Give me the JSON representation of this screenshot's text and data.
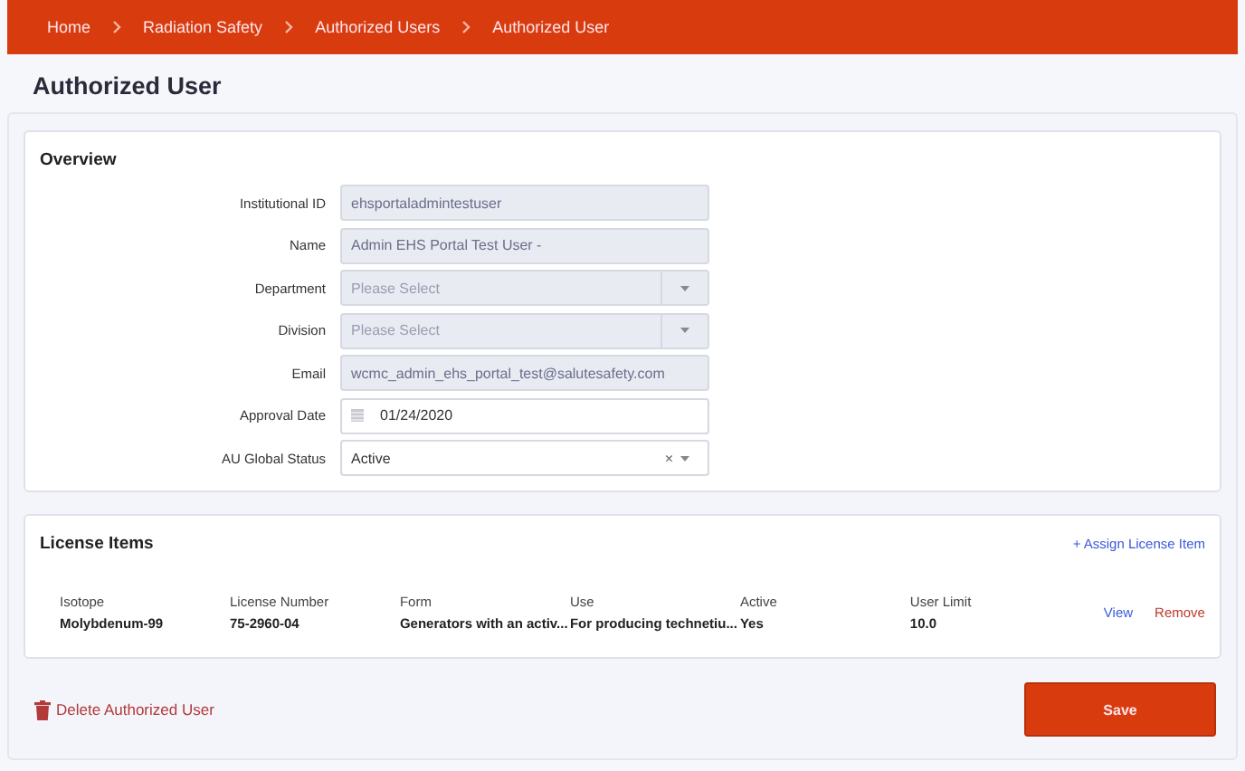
{
  "breadcrumb": [
    "Home",
    "Radiation Safety",
    "Authorized Users",
    "Authorized User"
  ],
  "page_title": "Authorized User",
  "overview": {
    "title": "Overview",
    "fields": [
      {
        "label": "Institutional ID",
        "kind": "text",
        "disabled": true,
        "value": "ehsportaladmintestuser"
      },
      {
        "label": "Name",
        "kind": "text",
        "disabled": true,
        "value": "Admin EHS Portal Test User -"
      },
      {
        "label": "Department",
        "kind": "select",
        "disabled": true,
        "placeholder": "Please Select"
      },
      {
        "label": "Division",
        "kind": "select",
        "disabled": true,
        "placeholder": "Please Select"
      },
      {
        "label": "Email",
        "kind": "text",
        "disabled": true,
        "value": "wcmc_admin_ehs_portal_test@salutesafety.com"
      },
      {
        "label": "Approval Date",
        "kind": "date",
        "disabled": false,
        "value": "01/24/2020"
      },
      {
        "label": "AU Global Status",
        "kind": "combo",
        "disabled": false,
        "value": "Active",
        "clear": "×"
      }
    ]
  },
  "license_items": {
    "title": "License Items",
    "assign_link": "+ Assign License Item",
    "columns": [
      {
        "header": "Isotope",
        "value": "Molybdenum-99"
      },
      {
        "header": "License Number",
        "value": "75-2960-04"
      },
      {
        "header": "Form",
        "value": "Generators with an activ..."
      },
      {
        "header": "Use",
        "value": "For producing technetiu..."
      },
      {
        "header": "Active",
        "value": "Yes"
      },
      {
        "header": "User Limit",
        "value": "10.0"
      }
    ],
    "actions": [
      "View",
      "Remove"
    ]
  },
  "delete_link": "Delete Authorized User",
  "save_button": "Save"
}
